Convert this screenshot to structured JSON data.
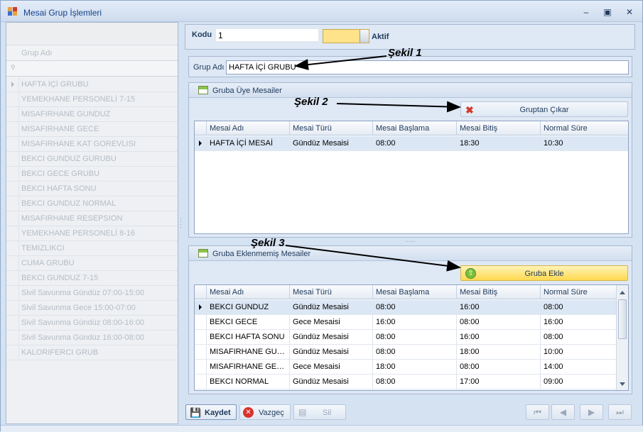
{
  "window": {
    "title": "Mesai Grup İşlemleri"
  },
  "left_panel": {
    "column_header": "Grup Adı",
    "filter_icon": "filter-icon",
    "rows": [
      "HAFTA İÇİ GRUBU",
      "YEMEKHANE PERSONELİ  7-15",
      "MISAFIRHANE GUNDUZ",
      "MISAFIRHANE GECE",
      "MISAFIRHANE KAT GOREVLISI",
      "BEKCI GUNDUZ GURUBU",
      "BEKCI GECE GRUBU",
      "BEKCI HAFTA SONU",
      "BEKCI GUNDUZ NORMAL",
      "MISAFIRHANE RESEPSION",
      "YEMEKHANE PERSONELİ 8-16",
      "TEMIZLIKCI",
      "CUMA GRUBU",
      "BEKCI GUNDUZ 7-15",
      "Sivil Savunma Gündüz 07:00-15:00",
      "Sivil Savunma Gece 15:00-07:00",
      "Sivil Savunma Gündüz 08:00-16:00",
      "Sivil Savunma Gündüz 16:00-08:00",
      "KALORIFERCI GRUB"
    ]
  },
  "header": {
    "kodu_label": "Kodu",
    "kodu_value": "1",
    "aktif_label": "Aktif",
    "aktif_on": true
  },
  "grup": {
    "label": "Grup Adı",
    "value": "HAFTA İÇİ GRUBU"
  },
  "members": {
    "title": "Gruba Üye Mesailer",
    "remove_button": "Gruptan Çıkar",
    "columns": [
      "Mesai Adı",
      "Mesai Türü",
      "Mesai Başlama",
      "Mesai Bitiş",
      "Normal Süre"
    ],
    "rows": [
      [
        "HAFTA İÇİ MESAİ",
        "Gündüz Mesaisi",
        "08:00",
        "18:30",
        "10:30"
      ]
    ]
  },
  "available": {
    "title": "Gruba Eklenmemiş Mesailer",
    "add_button": "Gruba Ekle",
    "columns": [
      "Mesai Adı",
      "Mesai Türü",
      "Mesai Başlama",
      "Mesai Bitiş",
      "Normal Süre"
    ],
    "rows": [
      [
        "BEKCI GUNDUZ",
        "Gündüz Mesaisi",
        "08:00",
        "16:00",
        "08:00"
      ],
      [
        "BEKCI GECE",
        "Gece Mesaisi",
        "16:00",
        "08:00",
        "16:00"
      ],
      [
        "BEKCI HAFTA SONU",
        "Gündüz Mesaisi",
        "08:00",
        "16:00",
        "08:00"
      ],
      [
        "MISAFIRHANE GUNDUZ",
        "Gündüz Mesaisi",
        "08:00",
        "18:00",
        "10:00"
      ],
      [
        "MISAFIRHANE GECE",
        "Gece Mesaisi",
        "18:00",
        "08:00",
        "14:00"
      ],
      [
        "BEKCI NORMAL",
        "Gündüz Mesaisi",
        "08:00",
        "17:00",
        "09:00"
      ]
    ]
  },
  "annotations": {
    "a1": "Şekil 1",
    "a2": "Şekil 2",
    "a3": "Şekil 3"
  },
  "toolbar": {
    "save": "Kaydet",
    "cancel": "Vazgeç",
    "delete": "Sil"
  }
}
